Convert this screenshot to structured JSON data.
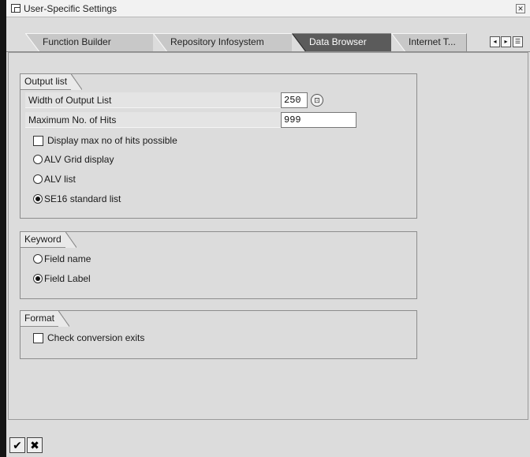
{
  "window": {
    "title": "User-Specific Settings",
    "close_icon": "close-icon"
  },
  "tabs": [
    {
      "label": "Function Builder",
      "active": false
    },
    {
      "label": "Repository Infosystem",
      "active": false
    },
    {
      "label": "Data Browser",
      "active": true
    },
    {
      "label": "Internet T...",
      "active": false
    }
  ],
  "tab_controls": {
    "prev": "◂",
    "next": "▸",
    "list": "☰"
  },
  "output_list": {
    "title": "Output list",
    "width_label": "Width of Output List",
    "width_value": "250",
    "max_hits_label": "Maximum No. of Hits",
    "max_hits_value": "999",
    "display_max_label": "Display max no of hits possible",
    "display_max_checked": false,
    "options": [
      {
        "label": "ALV Grid display",
        "selected": false
      },
      {
        "label": "ALV list",
        "selected": false
      },
      {
        "label": "SE16 standard list",
        "selected": true
      }
    ]
  },
  "keyword": {
    "title": "Keyword",
    "options": [
      {
        "label": "Field name",
        "selected": false
      },
      {
        "label": "Field Label",
        "selected": true
      }
    ]
  },
  "format": {
    "title": "Format",
    "check_conversion_label": "Check conversion exits",
    "check_conversion_checked": false
  },
  "footer": {
    "confirm_symbol": "✔",
    "cancel_symbol": "✖"
  }
}
